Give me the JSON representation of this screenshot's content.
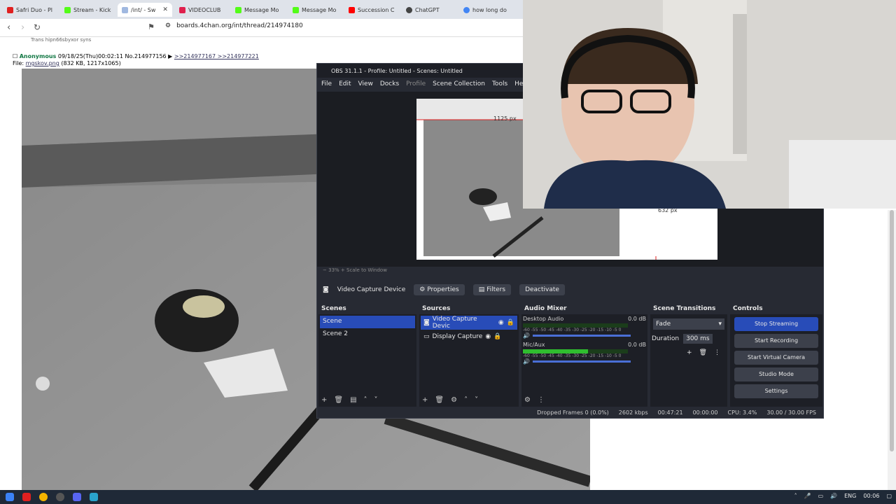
{
  "browser": {
    "tabs": [
      {
        "label": "Safri Duo - Pl",
        "color": "#e02020"
      },
      {
        "label": "Stream - Kick",
        "color": "#53fc18"
      },
      {
        "label": "/int/ - Sw",
        "color": "#a0b8e0",
        "active": true
      },
      {
        "label": "VIDEOCLUB",
        "color": "#e0204d"
      },
      {
        "label": "Message Mo",
        "color": "#53fc18"
      },
      {
        "label": "Message Mo",
        "color": "#53fc18"
      },
      {
        "label": "Succession C",
        "color": "#ff0000"
      },
      {
        "label": "ChatGPT",
        "color": "#444444"
      },
      {
        "label": "how long do",
        "color": "#4285f4"
      }
    ],
    "url": "boards.4chan.org/int/thread/214974180"
  },
  "post": {
    "cut_text": "Trans hipn66sbyxor syns",
    "name": "Anonymous",
    "datetime": "09/18/25(Thu)00:02:11 No.214977156",
    "replies": ">>214977167 >>214977221",
    "file_label": "File:",
    "filename": "mgskov.png",
    "fileinfo": "(832 KB, 1217x1065)"
  },
  "obs": {
    "title": "OBS 31.1.1 - Profile: Untitled - Scenes: Untitled",
    "menu": [
      "File",
      "Edit",
      "View",
      "Docks",
      "Profile",
      "Scene Collection",
      "Tools",
      "Help"
    ],
    "preview_label_1": "1125 px",
    "preview_label_2": "632 px",
    "zoom": "33%",
    "zoom_mode": "Scale to Window",
    "context": {
      "source": "Video Capture Device",
      "properties": "Properties",
      "filters": "Filters",
      "deactivate": "Deactivate"
    },
    "scenes": {
      "title": "Scenes",
      "items": [
        "Scene",
        "Scene 2"
      ]
    },
    "sources": {
      "title": "Sources",
      "items": [
        "Video Capture Devic",
        "Display Capture"
      ]
    },
    "mixer": {
      "title": "Audio Mixer",
      "channels": [
        {
          "name": "Desktop Audio",
          "db": "0.0 dB",
          "level": 0.0
        },
        {
          "name": "Mic/Aux",
          "db": "0.0 dB",
          "level": 0.62
        }
      ],
      "scale": "-60 -55 -50 -45 -40 -35 -30 -25 -20 -15 -10 -5 0"
    },
    "transitions": {
      "title": "Scene Transitions",
      "type": "Fade",
      "duration_label": "Duration",
      "duration": "300 ms"
    },
    "controls": {
      "title": "Controls",
      "buttons": [
        "Stop Streaming",
        "Start Recording",
        "Start Virtual Camera",
        "Studio Mode",
        "Settings"
      ]
    },
    "status": {
      "dropped": "Dropped Frames 0 (0.0%)",
      "kbps": "2602 kbps",
      "live": "00:47:21",
      "rec": "00:00:00",
      "cpu": "CPU: 3.4%",
      "fps": "30.00 / 30.00 FPS"
    }
  },
  "taskbar": {
    "lang": "ENG",
    "time": "00:06"
  }
}
